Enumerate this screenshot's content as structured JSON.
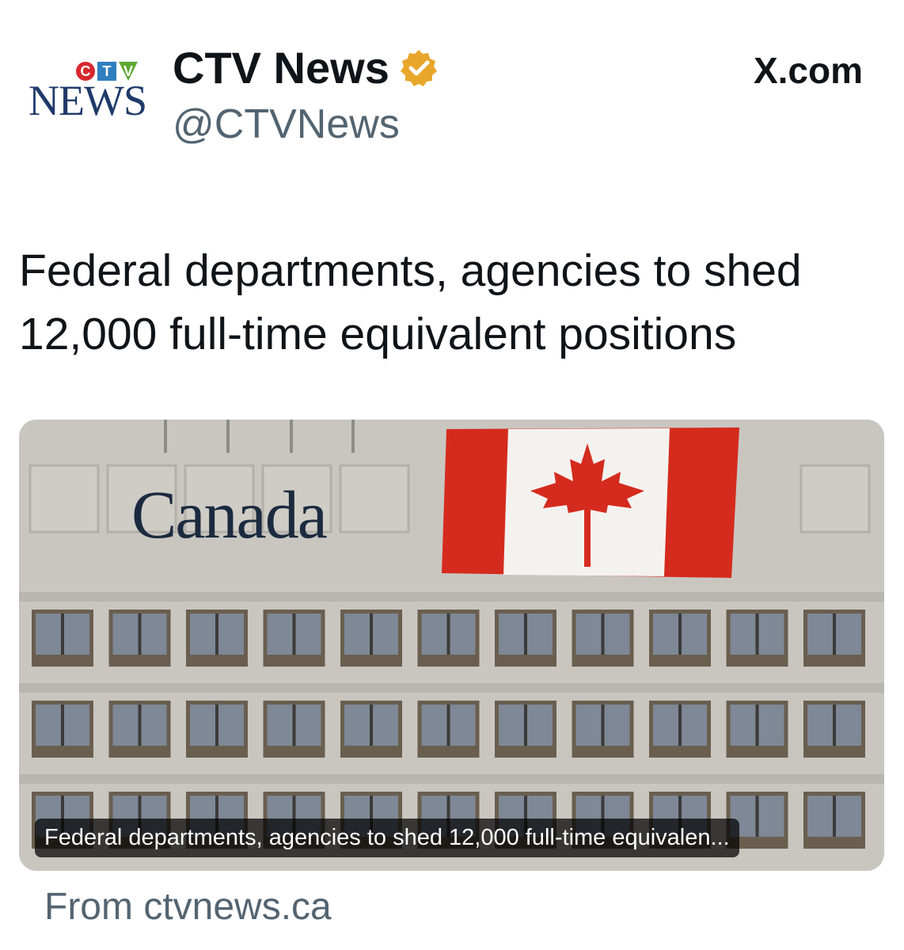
{
  "header": {
    "logo_letters": [
      "C",
      "T",
      "V"
    ],
    "logo_word": "NEWS",
    "display_name": "CTV News",
    "handle": "@CTVNews",
    "site": "X.com"
  },
  "headline": "Federal departments, agencies to shed 12,000 full-time equivalent positions",
  "card": {
    "building_sign": "Canada",
    "caption": "Federal departments, agencies to shed 12,000 full-time equivalen..."
  },
  "source": "From ctvnews.ca",
  "colors": {
    "verified": "#e8a62a",
    "ctv_red": "#d7282f",
    "ctv_blue": "#2f7fc1",
    "ctv_green": "#5da833",
    "flag_red": "#d52b1e"
  }
}
